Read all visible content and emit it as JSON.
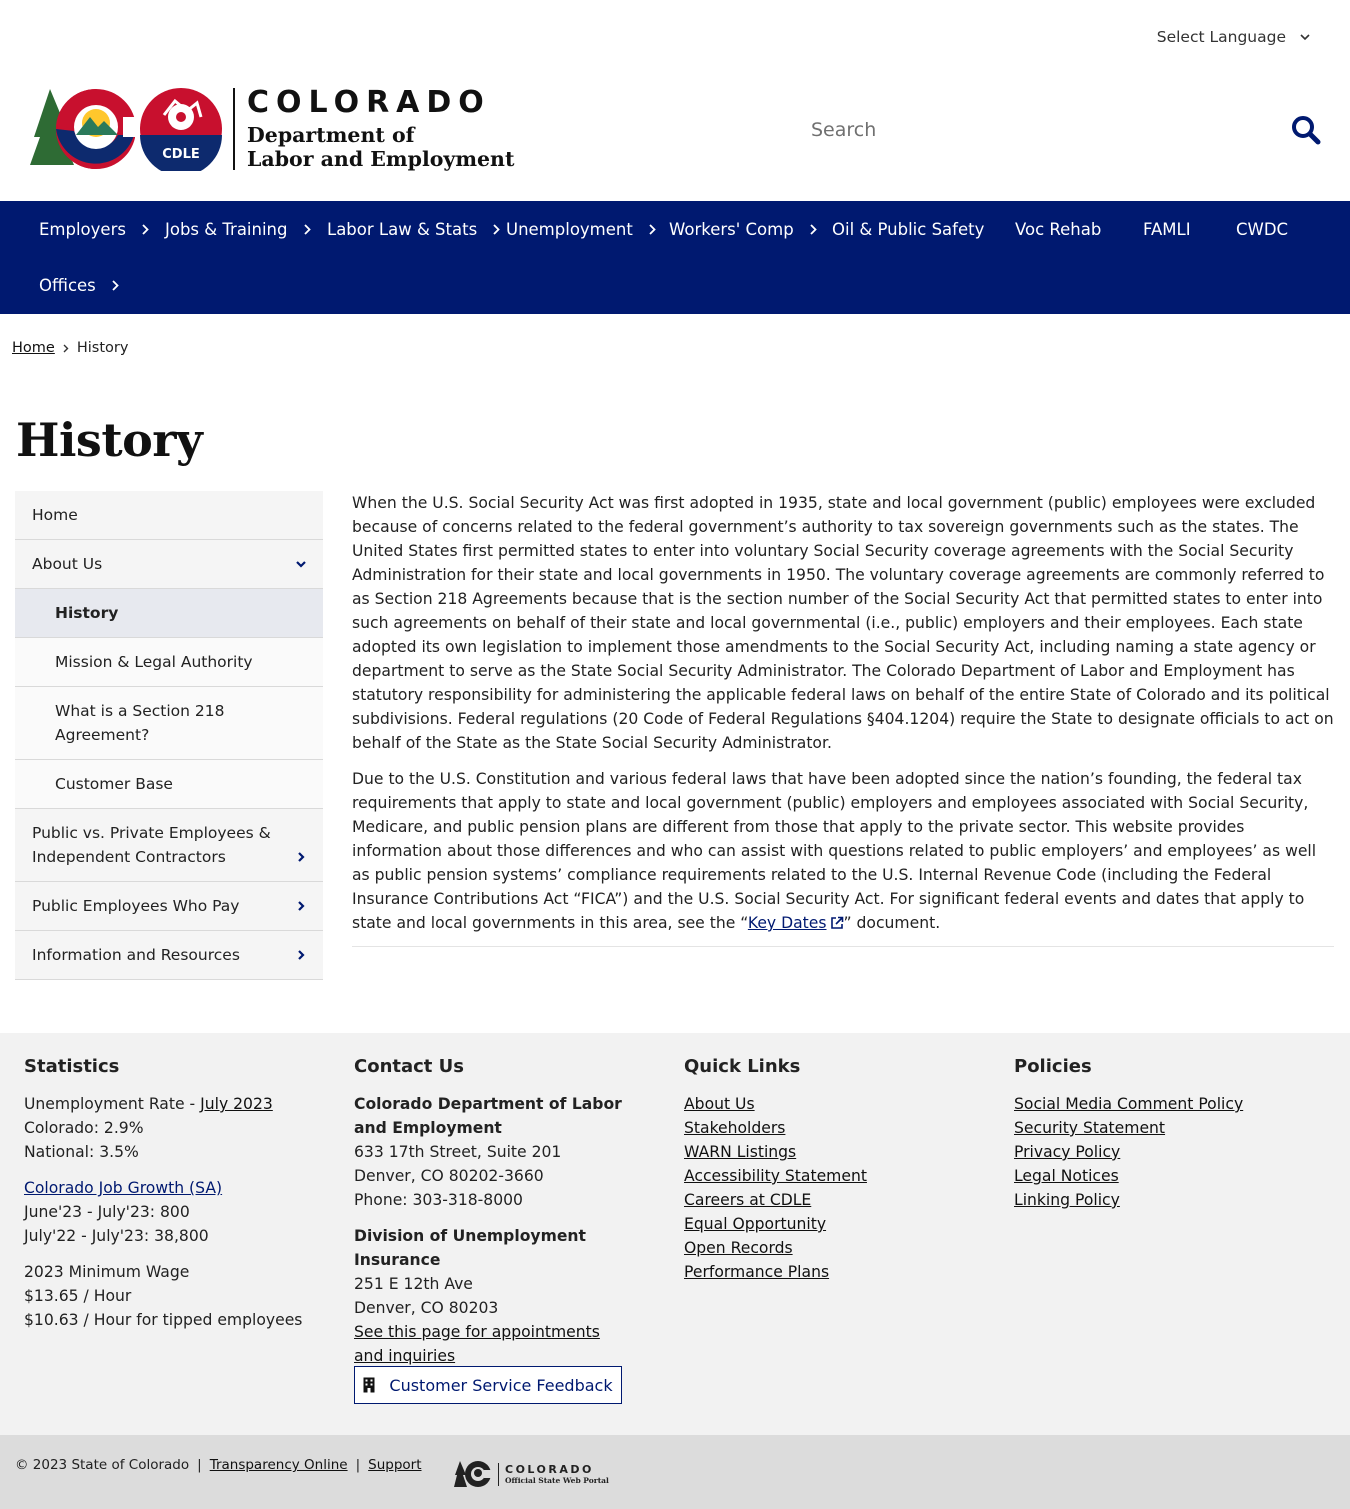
{
  "header": {
    "language_label": "Select Language",
    "brand_state": "COLORADO",
    "brand_dept_line1": "Department of",
    "brand_dept_line2": "Labor and Employment",
    "cdle_badge": "CDLE",
    "search_placeholder": "Search"
  },
  "nav": {
    "items": [
      {
        "label": "Employers"
      },
      {
        "label": "Jobs & Training"
      },
      {
        "label": "Labor Law & Stats"
      },
      {
        "label": "Unemployment"
      },
      {
        "label": "Workers' Comp"
      },
      {
        "label": "Oil & Public Safety"
      },
      {
        "label": "Voc Rehab"
      },
      {
        "label": "FAMLI"
      },
      {
        "label": "CWDC"
      },
      {
        "label": "Offices"
      }
    ]
  },
  "breadcrumb": {
    "home": "Home",
    "current": "History"
  },
  "page": {
    "title": "History"
  },
  "sidenav": {
    "items": [
      {
        "label": "Home"
      },
      {
        "label": "About Us"
      },
      {
        "label": "History"
      },
      {
        "label": "Mission & Legal Authority"
      },
      {
        "label": "What is a Section 218 Agreement?"
      },
      {
        "label": "Customer Base"
      },
      {
        "label": "Public vs. Private Employees & Independent Contractors"
      },
      {
        "label": "Public Employees Who Pay"
      },
      {
        "label": "Information and Resources"
      }
    ]
  },
  "content": {
    "para1": "When the U.S. Social Security Act was first adopted in 1935, state and local government (public) employees were excluded because of concerns related to the federal government’s authority to tax sovereign governments such as the states.  The United States first permitted states to enter into voluntary Social Security coverage agreements with the Social Security Administration for their state and local governments in 1950.  The voluntary coverage agreements are commonly referred to as Section 218 Agreements because that is the section number of the Social Security Act that permitted states to enter into such agreements on behalf of their state and local governmental (i.e., public) employers and their employees.  Each state adopted its own legislation to implement those amendments to the Social Security Act, including naming a state agency or department to serve as the State Social Security Administrator.  The Colorado Department of Labor and Employment has statutory responsibility for administering the applicable federal laws on behalf of the entire State of Colorado and its political subdivisions.  Federal regulations (20 Code of Federal Regulations §404.1204) require the State to designate officials to act on behalf of the State as the State Social Security Administrator.",
    "para2_before_link": "Due to the U.S. Constitution and various federal laws that have been adopted since the nation’s founding, the federal tax requirements that apply to state and local government (public) employers and employees associated with Social Security, Medicare, and public pension plans are different from those that apply to the private sector.  This website provides information about those differences and who can assist with questions related to public employers’ and employees’ as well as public pension systems’ compliance requirements related to the U.S. Internal Revenue Code (including the Federal Insurance Contributions Act “FICA”) and the U.S. Social Security Act.  For significant federal events and dates that apply to state and local governments in this area, see the “",
    "para2_link": "Key Dates",
    "para2_after_link": "” document."
  },
  "footer": {
    "statistics": {
      "heading": "Statistics",
      "unemp_label": "Unemployment Rate - ",
      "unemp_link": "July 2023",
      "colorado": "Colorado: 2.9%",
      "national": "National: 3.5%",
      "job_growth_link": "Colorado Job Growth (SA)",
      "job_growth_1": "June'23 - July'23: 800",
      "job_growth_2": "July'22 - July'23: 38,800",
      "min_wage_heading": "2023 Minimum Wage",
      "min_wage_1": "$13.65 / Hour",
      "min_wage_2": "$10.63 / Hour for tipped employees"
    },
    "contact": {
      "heading": "Contact Us",
      "org_name": "Colorado Department of Labor and Employment",
      "address1": "633 17th Street, Suite 201",
      "address2": "Denver, CO  80202-3660",
      "phone": "Phone: 303-318-8000",
      "div_name": "Division of Unemployment Insurance",
      "div_address1": "251 E 12th Ave",
      "div_address2": "Denver, CO  80203",
      "div_link": "See this page for appointments and inquiries",
      "feedback_button": "Customer Service Feedback"
    },
    "quick_links": {
      "heading": "Quick Links",
      "items": [
        {
          "label": "About Us"
        },
        {
          "label": "Stakeholders"
        },
        {
          "label": "WARN Listings"
        },
        {
          "label": "Accessibility Statement"
        },
        {
          "label": "Careers at CDLE"
        },
        {
          "label": "Equal Opportunity"
        },
        {
          "label": "Open Records"
        },
        {
          "label": "Performance Plans"
        }
      ]
    },
    "policies": {
      "heading": "Policies",
      "items": [
        {
          "label": "Social Media Comment Policy"
        },
        {
          "label": "Security Statement"
        },
        {
          "label": "Privacy Policy"
        },
        {
          "label": "Legal Notices"
        },
        {
          "label": "Linking Policy"
        }
      ]
    }
  },
  "bottom": {
    "copyright": "© 2023 State of Colorado",
    "sep": "|",
    "transparency": "Transparency Online",
    "support": "Support",
    "portal_state": "COLORADO",
    "portal_sub": "Official State Web Portal"
  },
  "colors": {
    "brand_navy": "#001970",
    "footer_bg": "#f2f2f2",
    "bottom_bar_bg": "#dcdcdc"
  },
  "icons": [
    "chevron-down-icon",
    "chevron-right-icon",
    "search-icon",
    "external-link-icon",
    "building-icon"
  ]
}
